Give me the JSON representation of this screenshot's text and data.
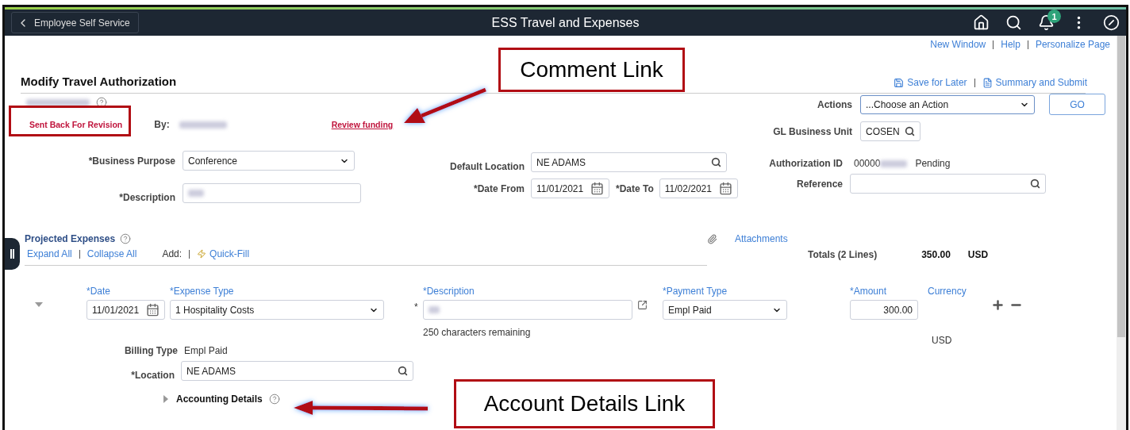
{
  "header": {
    "back_button": "Employee Self Service",
    "title": "ESS Travel and Expenses",
    "notification_count": "1"
  },
  "top_links": [
    "New Window",
    "Help",
    "Personalize Page"
  ],
  "page_title": "Modify Travel Authorization",
  "page_actions": [
    "Save for Later",
    "Summary and Submit"
  ],
  "status": "Sent Back For Revision",
  "by_label": "By:",
  "comment_link": "Review funding",
  "actions": {
    "label": "Actions",
    "value": "...Choose an Action",
    "go": "GO"
  },
  "gl_business_unit": {
    "label": "GL Business Unit",
    "value": "COSEN"
  },
  "business_purpose": {
    "label": "*Business Purpose",
    "value": "Conference"
  },
  "description": {
    "label": "*Description"
  },
  "default_location": {
    "label": "Default Location",
    "value": "NE ADAMS"
  },
  "date_from": {
    "label": "*Date From",
    "value": "11/01/2021"
  },
  "date_to": {
    "label": "*Date To",
    "value": "11/02/2021"
  },
  "authorization_id": {
    "label": "Authorization ID",
    "value": "00000",
    "status": "Pending"
  },
  "reference": {
    "label": "Reference"
  },
  "projected_expenses": {
    "title": "Projected Expenses",
    "links": [
      "Expand All",
      "Collapse All"
    ],
    "add_label": "Add:",
    "quick_fill": "Quick-Fill",
    "attachments": "Attachments",
    "totals_label": "Totals (2 Lines)",
    "total": "350.00",
    "currency": "USD",
    "line": {
      "expanded": true,
      "columns": [
        "*Date",
        "*Expense Type",
        "*Description",
        "*Payment Type",
        "*Amount",
        "Currency"
      ],
      "date": "11/01/2021",
      "expense_type": "1 Hospitality Costs",
      "description_mark": "*",
      "remaining": "250 characters remaining",
      "payment_type": "Empl Paid",
      "amount": "300.00",
      "currency": "USD",
      "billing_type_label": "Billing Type",
      "billing_type": "Empl Paid",
      "location_label": "*Location",
      "location": "NE ADAMS",
      "accounting_details": "Accounting Details",
      "accounting_expanded": false
    }
  },
  "annotations": [
    {
      "text": "Comment Link"
    },
    {
      "text": "Account Details Link"
    }
  ]
}
